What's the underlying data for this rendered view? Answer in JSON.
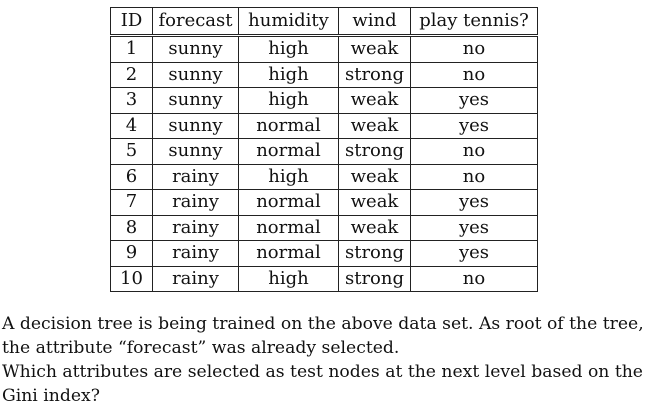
{
  "table": {
    "columns": [
      "ID",
      "forecast",
      "humidity",
      "wind",
      "play tennis?"
    ],
    "rows": [
      [
        "1",
        "sunny",
        "high",
        "weak",
        "no"
      ],
      [
        "2",
        "sunny",
        "high",
        "strong",
        "no"
      ],
      [
        "3",
        "sunny",
        "high",
        "weak",
        "yes"
      ],
      [
        "4",
        "sunny",
        "normal",
        "weak",
        "yes"
      ],
      [
        "5",
        "sunny",
        "normal",
        "strong",
        "no"
      ],
      [
        "6",
        "rainy",
        "high",
        "weak",
        "no"
      ],
      [
        "7",
        "rainy",
        "normal",
        "weak",
        "yes"
      ],
      [
        "8",
        "rainy",
        "normal",
        "weak",
        "yes"
      ],
      [
        "9",
        "rainy",
        "normal",
        "strong",
        "yes"
      ],
      [
        "10",
        "rainy",
        "high",
        "strong",
        "no"
      ]
    ]
  },
  "text": {
    "paragraph1": "A decision tree is being trained on the above data set. As root of the tree, the attribute “forecast” was already selected.",
    "paragraph2": "Which attributes are selected as test nodes at the next level based on the Gini index?"
  }
}
